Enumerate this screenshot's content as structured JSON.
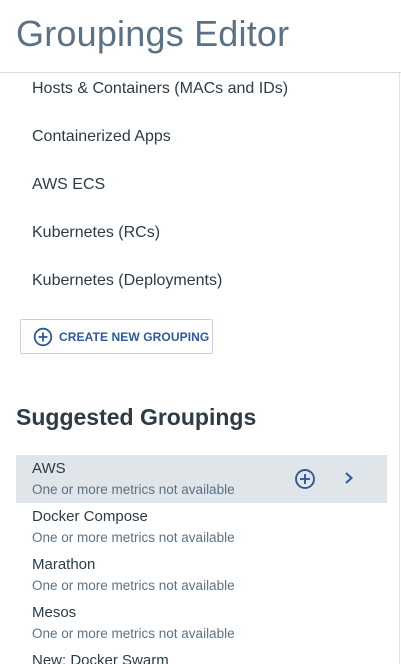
{
  "header": {
    "title": "Groupings Editor"
  },
  "groupings": [
    "Hosts & Containers (MACs and IDs)",
    "Containerized Apps",
    "AWS ECS",
    "Kubernetes (RCs)",
    "Kubernetes (Deployments)"
  ],
  "create_button": {
    "label": "CREATE NEW GROUPING",
    "icon": "plus-circle-icon"
  },
  "suggested": {
    "title": "Suggested Groupings",
    "items": [
      {
        "name": "AWS",
        "note": "One or more metrics not available"
      },
      {
        "name": "Docker Compose",
        "note": "One or more metrics not available"
      },
      {
        "name": "Marathon",
        "note": "One or more metrics not available"
      },
      {
        "name": "Mesos",
        "note": "One or more metrics not available"
      },
      {
        "name": "New: Docker Swarm",
        "note": ""
      }
    ]
  },
  "colors": {
    "accent": "#2f5a9a",
    "highlight_row": "#dfe5e8",
    "title": "#5b7286"
  }
}
